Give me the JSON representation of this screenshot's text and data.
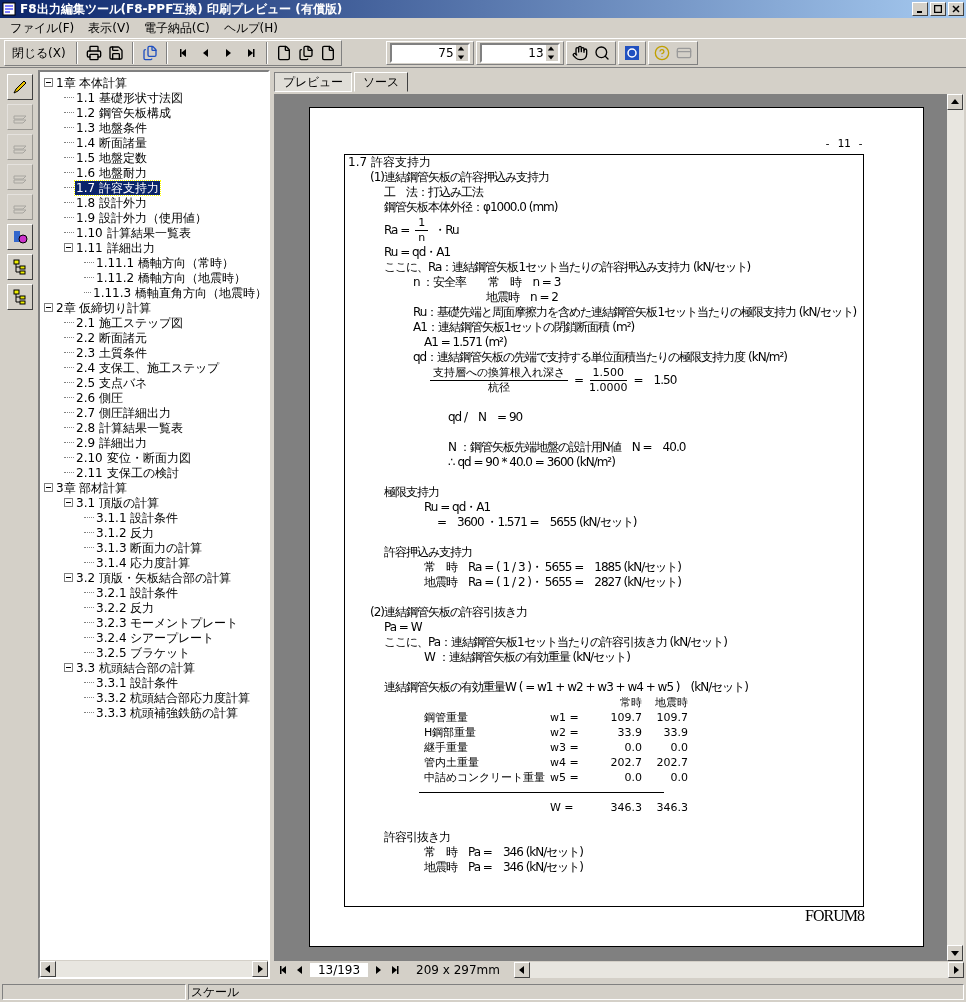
{
  "window": {
    "title": "F8出力編集ツール(F8-PPF互換) 印刷プレビュー (有償版)"
  },
  "menu": [
    "ファイル(F)",
    "表示(V)",
    "電子納品(C)",
    "ヘルプ(H)"
  ],
  "toolbar": {
    "close_button": "閉じる(X)",
    "zoom_value": "75",
    "page_value": "13"
  },
  "left_tools": [
    {
      "disabled": false
    },
    {
      "disabled": true
    },
    {
      "disabled": true
    },
    {
      "disabled": true
    },
    {
      "disabled": true
    },
    {
      "disabled": false
    },
    {
      "disabled": false
    },
    {
      "disabled": false
    }
  ],
  "tree": [
    {
      "label": "1章 本体計算",
      "selected": false,
      "expanded": true,
      "children": [
        {
          "label": "1.1 基礎形状寸法図",
          "selected": false
        },
        {
          "label": "1.2 鋼管矢板構成",
          "selected": false
        },
        {
          "label": "1.3 地盤条件",
          "selected": false
        },
        {
          "label": "1.4 断面諸量",
          "selected": false
        },
        {
          "label": "1.5 地盤定数",
          "selected": false
        },
        {
          "label": "1.6 地盤耐力",
          "selected": false
        },
        {
          "label": "1.7 許容支持力",
          "selected": true
        },
        {
          "label": "1.8 設計外力",
          "selected": false
        },
        {
          "label": "1.9 設計外力（使用値）",
          "selected": false
        },
        {
          "label": "1.10 計算結果一覧表",
          "selected": false
        },
        {
          "label": "1.11 詳細出力",
          "selected": false,
          "expanded": true,
          "children": [
            {
              "label": "1.11.1 橋軸方向（常時）",
              "selected": false
            },
            {
              "label": "1.11.2 橋軸方向（地震時）",
              "selected": false
            },
            {
              "label": "1.11.3 橋軸直角方向（地震時）",
              "selected": false
            }
          ]
        }
      ]
    },
    {
      "label": "2章 仮締切り計算",
      "selected": false,
      "expanded": true,
      "children": [
        {
          "label": "2.1 施工ステップ図",
          "selected": false
        },
        {
          "label": "2.2 断面諸元",
          "selected": false
        },
        {
          "label": "2.3 土質条件",
          "selected": false
        },
        {
          "label": "2.4 支保工、施工ステップ",
          "selected": false
        },
        {
          "label": "2.5 支点バネ",
          "selected": false
        },
        {
          "label": "2.6 側圧",
          "selected": false
        },
        {
          "label": "2.7 側圧詳細出力",
          "selected": false
        },
        {
          "label": "2.8 計算結果一覧表",
          "selected": false
        },
        {
          "label": "2.9 詳細出力",
          "selected": false
        },
        {
          "label": "2.10 変位・断面力図",
          "selected": false
        },
        {
          "label": "2.11 支保工の検討",
          "selected": false
        }
      ]
    },
    {
      "label": "3章 部材計算",
      "selected": false,
      "expanded": true,
      "children": [
        {
          "label": "3.1 頂版の計算",
          "selected": false,
          "expanded": true,
          "children": [
            {
              "label": "3.1.1 設計条件",
              "selected": false
            },
            {
              "label": "3.1.2 反力",
              "selected": false
            },
            {
              "label": "3.1.3 断面力の計算",
              "selected": false
            },
            {
              "label": "3.1.4 応力度計算",
              "selected": false
            }
          ]
        },
        {
          "label": "3.2 頂版・矢板結合部の計算",
          "selected": false,
          "expanded": true,
          "children": [
            {
              "label": "3.2.1 設計条件",
              "selected": false
            },
            {
              "label": "3.2.2 反力",
              "selected": false
            },
            {
              "label": "3.2.3 モーメントプレート",
              "selected": false
            },
            {
              "label": "3.2.4 シアープレート",
              "selected": false
            },
            {
              "label": "3.2.5 ブラケット",
              "selected": false
            }
          ]
        },
        {
          "label": "3.3 杭頭結合部の計算",
          "selected": false,
          "expanded": true,
          "children": [
            {
              "label": "3.3.1 設計条件",
              "selected": false
            },
            {
              "label": "3.3.2 杭頭結合部応力度計算",
              "selected": false
            },
            {
              "label": "3.3.3 杭頭補強鉄筋の計算",
              "selected": false
            }
          ]
        }
      ]
    }
  ],
  "tabs": [
    {
      "label": "プレビュー",
      "selected": true
    },
    {
      "label": "ソース",
      "selected": false
    }
  ],
  "page": {
    "page_number": "- 11 -",
    "footer": "FORUM8",
    "blocks": [
      {
        "lines": [
          {
            "kind": "title",
            "text": "1.7 許容支持力"
          },
          {
            "kind": "section",
            "text": "(1)連結鋼管矢板の許容押込み支持力"
          },
          {
            "kind": "body",
            "text": "工　法：打込み工法"
          },
          {
            "kind": "body",
            "text": "鋼管矢板本体外径：φ1000.0 (mm)"
          },
          {
            "kind": "body",
            "parts": [
              {
                "text": "Ra ="
              },
              {
                "num": "1",
                "den": "n"
              },
              {
                "text": "・Ru"
              }
            ]
          },
          {
            "kind": "body",
            "text": "Ru = qd・A1"
          },
          {
            "kind": "body",
            "text": "ここに、Ra：連結鋼管矢板1セット当たりの許容押込み支持力 (kN/セット)"
          },
          {
            "kind": "label",
            "text": "n ：安全率　　常　時　n = 3"
          },
          {
            "kind": "cont",
            "text": "地震時　n = 2"
          },
          {
            "kind": "label",
            "text": "Ru：基礎先端と周面摩擦力を含めた連結鋼管矢板1セット当たりの極限支持力 (kN/セット)"
          },
          {
            "kind": "label",
            "text": "A1：連結鋼管矢板1セットの閉鎖断面積 (m²)"
          },
          {
            "kind": "detail",
            "text": "A1 = 1.571 (m²)"
          },
          {
            "kind": "label",
            "text": "qd：連結鋼管矢板の先端で支持する単位面積当たりの極限支持力度 (kN/m²)"
          },
          {
            "kind": "detail",
            "parts": [
              {
                "num": "支持層への換算根入れ深さ",
                "den": "杭径"
              },
              {
                "text": "="
              },
              {
                "num": "1.500",
                "den": "1.0000"
              },
              {
                "text": "=　1.50"
              }
            ]
          }
        ]
      },
      {
        "lines": [
          {
            "kind": "note",
            "text": "qd /　N　= 90"
          }
        ]
      },
      {
        "lines": [
          {
            "kind": "note",
            "text": "N ：鋼管矢板先端地盤の設計用N値　N =　40.0"
          },
          {
            "kind": "note",
            "text": "∴ qd = 90 * 40.0 = 3600 (kN/m²)"
          }
        ]
      },
      {
        "lines": [
          {
            "kind": "body",
            "text": "極限支持力"
          },
          {
            "kind": "detail",
            "text": "Ru = qd・A1"
          },
          {
            "kind": "deeper",
            "text": "=　3600 ・1.571 =　5655 (kN/セット)"
          }
        ]
      },
      {
        "lines": [
          {
            "kind": "body",
            "text": "許容押込み支持力"
          },
          {
            "kind": "detail",
            "text": "常　時　Ra = ( 1 / 3 )・ 5655 =　1885 (kN/セット)"
          },
          {
            "kind": "detail",
            "text": "地震時　Ra = ( 1 / 2 )・ 5655 =　2827 (kN/セット)"
          }
        ]
      },
      {
        "lines": [
          {
            "kind": "section",
            "text": "(2)連結鋼管矢板の許容引抜き力"
          },
          {
            "kind": "body",
            "text": "Pa = W"
          },
          {
            "kind": "body",
            "text": "ここに、Pa：連結鋼管矢板1セット当たりの許容引抜き力 (kN/セット)"
          },
          {
            "kind": "detail",
            "text": "W ：連結鋼管矢板の有効重量 (kN/セット)"
          }
        ]
      },
      {
        "lines": [
          {
            "kind": "body",
            "text": "連結鋼管矢板の有効重量W ( = w1 + w2 + w3 + w4 + w5 )　(kN/セット)"
          },
          {
            "kind": "table",
            "header": [
              "常時",
              "地震時"
            ],
            "rows": [
              {
                "label": "鋼管重量",
                "symbol": "w1 =",
                "values": [
                  "109.7",
                  "109.7"
                ]
              },
              {
                "label": "H鋼部重量",
                "symbol": "w2 =",
                "values": [
                  "33.9",
                  "33.9"
                ]
              },
              {
                "label": "継手重量",
                "symbol": "w3 =",
                "values": [
                  "0.0",
                  "0.0"
                ]
              },
              {
                "label": "管内土重量",
                "symbol": "w4 =",
                "values": [
                  "202.7",
                  "202.7"
                ]
              },
              {
                "label": "中詰めコンクリート重量",
                "symbol": "w5 =",
                "values": [
                  "0.0",
                  "0.0"
                ]
              }
            ],
            "total": {
              "symbol": "W =",
              "values": [
                "346.3",
                "346.3"
              ]
            }
          }
        ]
      },
      {
        "lines": [
          {
            "kind": "body",
            "text": "許容引抜き力"
          },
          {
            "kind": "detail",
            "text": "常　時　Pa =　346 (kN/セット)"
          },
          {
            "kind": "detail",
            "text": "地震時　Pa =　346 (kN/セット)"
          }
        ]
      }
    ]
  },
  "navigator": {
    "page_field": "13/193",
    "paper_size": "209 x 297mm"
  },
  "status_bar": {
    "scale_label": "スケール"
  }
}
